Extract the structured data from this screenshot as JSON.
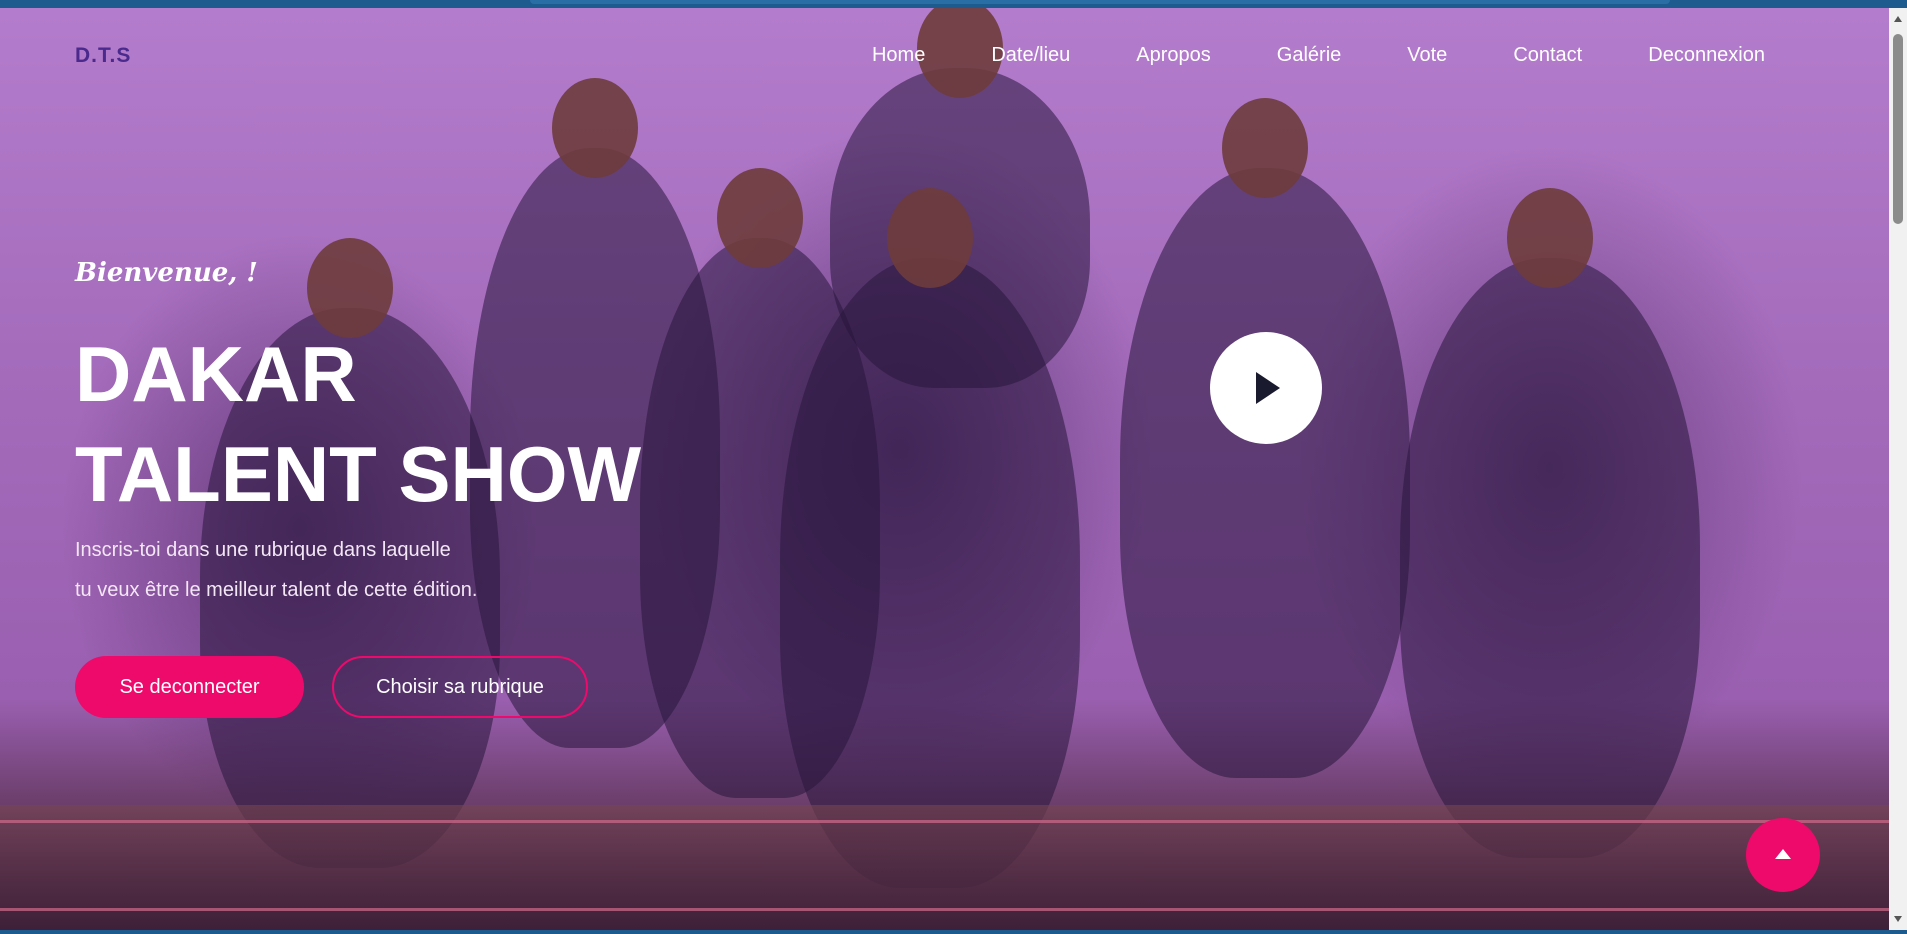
{
  "nav": {
    "logo": "D.T.S",
    "items": [
      {
        "label": "Home"
      },
      {
        "label": "Date/lieu"
      },
      {
        "label": "Apropos"
      },
      {
        "label": "Galérie"
      },
      {
        "label": "Vote"
      },
      {
        "label": "Contact"
      },
      {
        "label": "Deconnexion"
      }
    ]
  },
  "hero": {
    "welcome": "Bienvenue, !",
    "title_line1": "DAKAR",
    "title_line2": "TALENT SHOW",
    "subtitle_line1": "Inscris-toi dans une rubrique dans laquelle",
    "subtitle_line2": "tu veux être le meilleur talent de cette édition.",
    "primary_button": "Se deconnecter",
    "secondary_button": "Choisir sa rubrique"
  },
  "icons": {
    "play": "play-icon",
    "scroll_top": "arrow-up-icon"
  },
  "colors": {
    "accent": "#ee0a6b",
    "logo": "#4a2a8c",
    "overlay": "#a46bbb"
  }
}
